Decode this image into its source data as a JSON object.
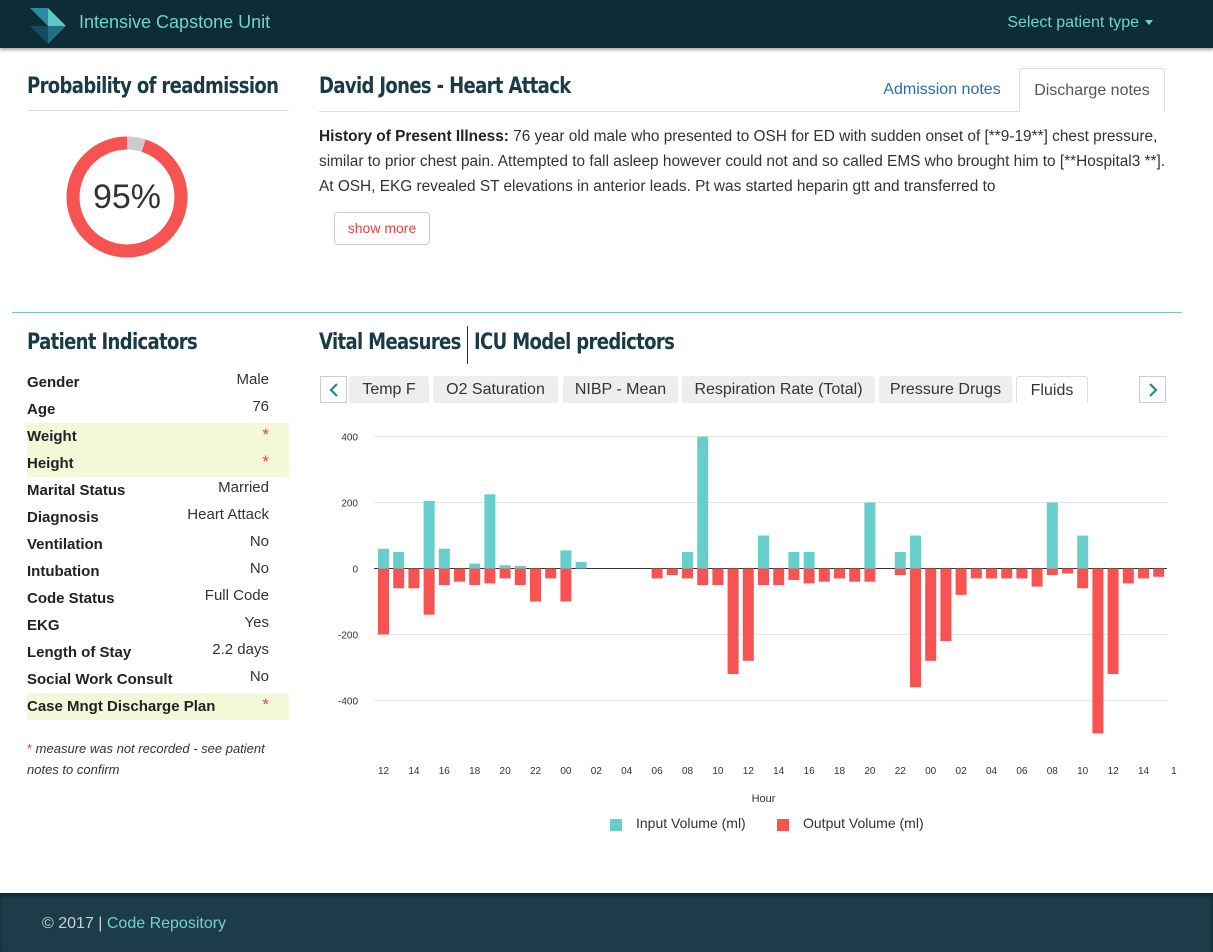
{
  "navbar": {
    "brand": "Intensive Capstone Unit",
    "select_label": "Select patient type",
    "logo_icon": "ribbon-logo-icon"
  },
  "probability": {
    "title": "Probability of readmission",
    "value_text": "95%",
    "value": 0.95,
    "color": "#f75353",
    "track_color": "#cccccc"
  },
  "patient": {
    "title": "David Jones - Heart Attack",
    "tabs": [
      {
        "label": "Admission notes",
        "active": false
      },
      {
        "label": "Discharge notes",
        "active": true
      }
    ],
    "hpi_label": "History of Present Illness:",
    "hpi_text": " 76 year old male who presented to OSH for ED with sudden onset of [**9-19**] chest pressure, similar to prior chest pain. Attempted to fall asleep however could not and so called EMS who brought him to [**Hospital3 **]. At OSH, EKG revealed ST elevations in anterior leads. Pt was started heparin gtt and transferred to",
    "show_more": "show more"
  },
  "indicators": {
    "title": "Patient Indicators",
    "rows": [
      {
        "label": "Gender",
        "value": "Male",
        "missing": false
      },
      {
        "label": "Age",
        "value": "76",
        "missing": false
      },
      {
        "label": "Weight",
        "value": "*",
        "missing": true
      },
      {
        "label": "Height",
        "value": "*",
        "missing": true
      },
      {
        "label": "Marital Status",
        "value": "Married",
        "missing": false
      },
      {
        "label": "Diagnosis",
        "value": "Heart Attack",
        "missing": false
      },
      {
        "label": "Ventilation",
        "value": "No",
        "missing": false
      },
      {
        "label": "Intubation",
        "value": "No",
        "missing": false
      },
      {
        "label": "Code Status",
        "value": "Full Code",
        "missing": false
      },
      {
        "label": "EKG",
        "value": "Yes",
        "missing": false
      },
      {
        "label": "Length of Stay",
        "value": "2.2 days",
        "missing": false
      },
      {
        "label": "Social Work Consult",
        "value": "No",
        "missing": false
      },
      {
        "label": "Case Mngt Discharge Plan",
        "value": "*",
        "missing": true
      }
    ],
    "note_star": "*",
    "note_text": " measure was not recorded - see patient notes to confirm"
  },
  "vitals": {
    "title": "Vital Measures",
    "icu_title": "ICU Model predictors",
    "tabs": [
      "Temp F",
      "O2 Saturation",
      "NIBP - Mean",
      "Respiration Rate (Total)",
      "Pressure Drugs",
      "Fluids"
    ],
    "active_tab": "Fluids"
  },
  "chart_data": {
    "type": "bar",
    "xlabel": "Hour",
    "ylabel": "",
    "ylim": [
      -520,
      420
    ],
    "yticks": [
      -400,
      -200,
      0,
      200,
      400
    ],
    "x_tick_labels": [
      "12",
      "14",
      "16",
      "18",
      "20",
      "22",
      "00",
      "02",
      "04",
      "06",
      "08",
      "10",
      "12",
      "14",
      "16",
      "18",
      "20",
      "22",
      "00",
      "02",
      "04",
      "06",
      "08",
      "10",
      "12",
      "14",
      "1"
    ],
    "grid": true,
    "legend_position": "bottom",
    "series": [
      {
        "name": "Input Volume (ml)",
        "color": "#67cfcb",
        "points": [
          {
            "h": 0,
            "v": 60
          },
          {
            "h": 1,
            "v": 50
          },
          {
            "h": 3,
            "v": 205
          },
          {
            "h": 4,
            "v": 60
          },
          {
            "h": 6,
            "v": 15
          },
          {
            "h": 7,
            "v": 225
          },
          {
            "h": 8,
            "v": 10
          },
          {
            "h": 9,
            "v": 8
          },
          {
            "h": 12,
            "v": 55
          },
          {
            "h": 13,
            "v": 20
          },
          {
            "h": 20,
            "v": 50
          },
          {
            "h": 21,
            "v": 400
          },
          {
            "h": 25,
            "v": 100
          },
          {
            "h": 27,
            "v": 50
          },
          {
            "h": 28,
            "v": 50
          },
          {
            "h": 32,
            "v": 200
          },
          {
            "h": 34,
            "v": 50
          },
          {
            "h": 35,
            "v": 100
          },
          {
            "h": 44,
            "v": 200
          },
          {
            "h": 46,
            "v": 100
          }
        ]
      },
      {
        "name": "Output Volume (ml)",
        "color": "#f75353",
        "points": [
          {
            "h": 0,
            "v": -200
          },
          {
            "h": 1,
            "v": -60
          },
          {
            "h": 2,
            "v": -60
          },
          {
            "h": 3,
            "v": -140
          },
          {
            "h": 4,
            "v": -50
          },
          {
            "h": 5,
            "v": -40
          },
          {
            "h": 6,
            "v": -50
          },
          {
            "h": 7,
            "v": -45
          },
          {
            "h": 8,
            "v": -30
          },
          {
            "h": 9,
            "v": -50
          },
          {
            "h": 10,
            "v": -100
          },
          {
            "h": 11,
            "v": -30
          },
          {
            "h": 12,
            "v": -100
          },
          {
            "h": 18,
            "v": -30
          },
          {
            "h": 19,
            "v": -20
          },
          {
            "h": 20,
            "v": -30
          },
          {
            "h": 21,
            "v": -50
          },
          {
            "h": 22,
            "v": -50
          },
          {
            "h": 23,
            "v": -320
          },
          {
            "h": 24,
            "v": -280
          },
          {
            "h": 25,
            "v": -50
          },
          {
            "h": 26,
            "v": -50
          },
          {
            "h": 27,
            "v": -35
          },
          {
            "h": 28,
            "v": -45
          },
          {
            "h": 29,
            "v": -40
          },
          {
            "h": 30,
            "v": -30
          },
          {
            "h": 31,
            "v": -40
          },
          {
            "h": 32,
            "v": -40
          },
          {
            "h": 34,
            "v": -20
          },
          {
            "h": 35,
            "v": -360
          },
          {
            "h": 36,
            "v": -280
          },
          {
            "h": 37,
            "v": -220
          },
          {
            "h": 38,
            "v": -80
          },
          {
            "h": 39,
            "v": -30
          },
          {
            "h": 40,
            "v": -30
          },
          {
            "h": 41,
            "v": -30
          },
          {
            "h": 42,
            "v": -30
          },
          {
            "h": 43,
            "v": -55
          },
          {
            "h": 44,
            "v": -20
          },
          {
            "h": 45,
            "v": -15
          },
          {
            "h": 46,
            "v": -60
          },
          {
            "h": 47,
            "v": -500
          },
          {
            "h": 48,
            "v": -320
          },
          {
            "h": 49,
            "v": -45
          },
          {
            "h": 50,
            "v": -30
          },
          {
            "h": 51,
            "v": -25
          }
        ]
      }
    ]
  },
  "footer": {
    "copyright": "© 2017 | ",
    "link": "Code Repository"
  }
}
